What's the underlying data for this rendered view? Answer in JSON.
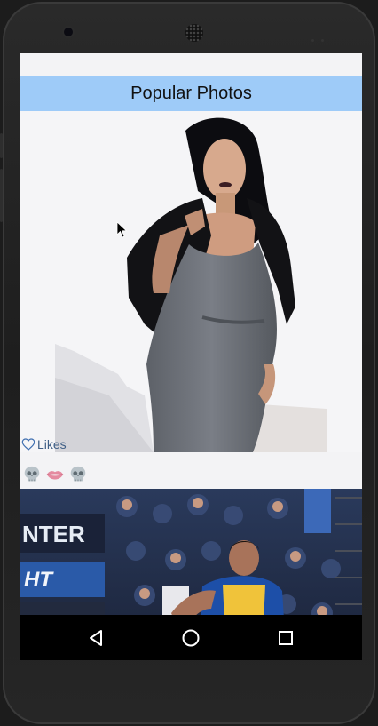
{
  "app": {
    "title": "Popular Photos"
  },
  "post": {
    "likes_label": "Likes",
    "icons": {
      "like": "heart-outline-icon",
      "reactions": [
        "skull-icon",
        "lips-icon",
        "skull-icon"
      ]
    }
  },
  "navbar": {
    "icons": [
      "back-triangle-icon",
      "home-circle-icon",
      "recents-square-icon"
    ]
  },
  "colors": {
    "header_bg": "#9ecbf8",
    "likes_text": "#3f5f86",
    "screen_bg": "#f3f3f5"
  }
}
